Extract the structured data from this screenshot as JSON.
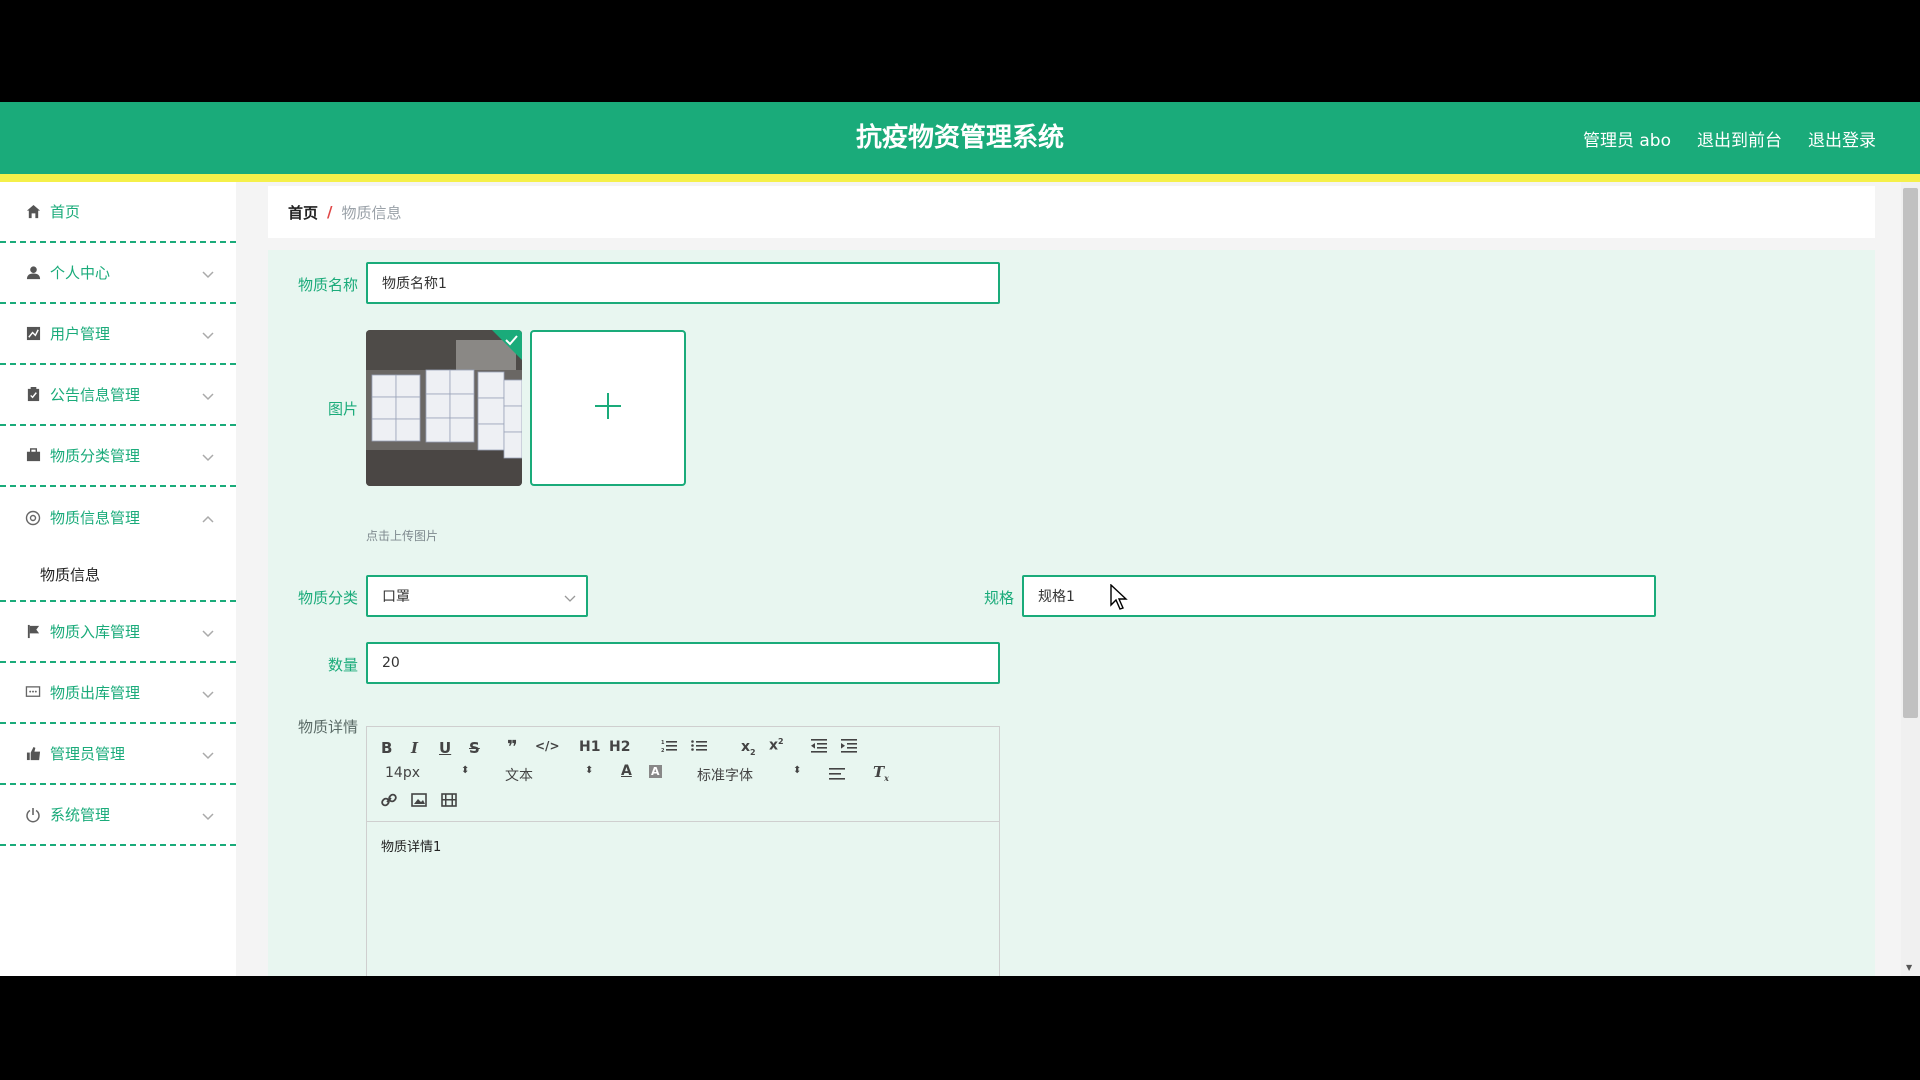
{
  "header": {
    "title": "抗疫物资管理系统",
    "admin_label": "管理员 abo",
    "to_frontend": "退出到前台",
    "logout": "退出登录"
  },
  "sidebar": {
    "items": [
      {
        "label": "首页",
        "icon": "home-icon"
      },
      {
        "label": "个人中心",
        "icon": "user-icon"
      },
      {
        "label": "用户管理",
        "icon": "chart-icon"
      },
      {
        "label": "公告信息管理",
        "icon": "clipboard-icon"
      },
      {
        "label": "物质分类管理",
        "icon": "briefcase-icon"
      },
      {
        "label": "物质信息管理",
        "icon": "aperture-icon"
      },
      {
        "label": "物质入库管理",
        "icon": "flag-icon"
      },
      {
        "label": "物质出库管理",
        "icon": "chat-icon"
      },
      {
        "label": "管理员管理",
        "icon": "thumb-icon"
      },
      {
        "label": "系统管理",
        "icon": "power-icon"
      }
    ],
    "sub_item": "物质信息"
  },
  "breadcrumb": {
    "home": "首页",
    "sep": "/",
    "current": "物质信息"
  },
  "form": {
    "name_label": "物质名称",
    "name_value": "物质名称1",
    "image_label": "图片",
    "upload_hint": "点击上传图片",
    "category_label": "物质分类",
    "category_value": "口罩",
    "spec_label": "规格",
    "spec_value": "规格1",
    "quantity_label": "数量",
    "quantity_value": "20",
    "detail_label": "物质详情",
    "detail_value": "物质详情1"
  },
  "editor": {
    "font_size": "14px",
    "text_type": "文本",
    "font_family": "标准字体",
    "h1": "H1",
    "h2": "H2"
  },
  "colors": {
    "primary": "#1aab7a",
    "accent": "#f5f04a"
  }
}
